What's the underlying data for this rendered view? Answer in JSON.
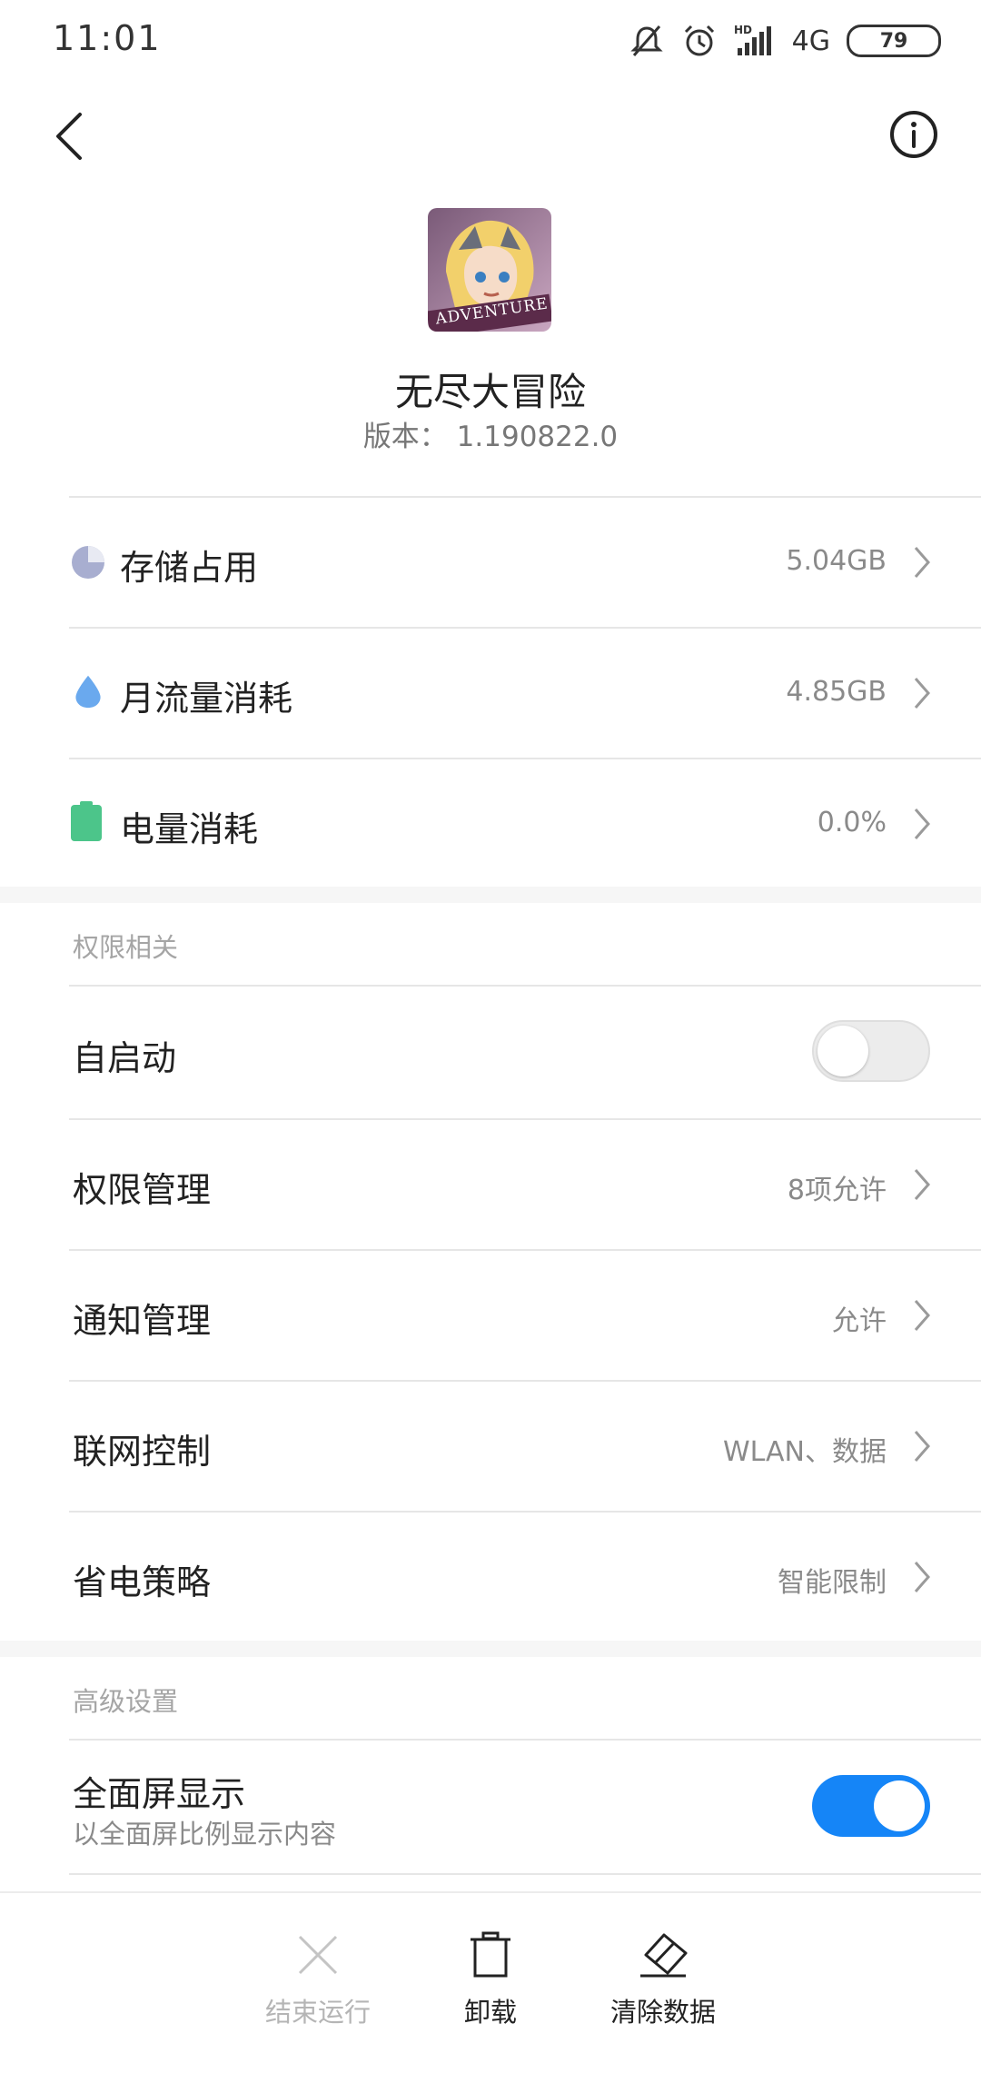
{
  "status_bar": {
    "time": "11:01",
    "network": "4G",
    "battery_level": "79",
    "icons": [
      "mute-icon",
      "alarm-icon",
      "hd-signal-icon",
      "battery-icon"
    ]
  },
  "nav": {
    "back_icon": "back-arrow-icon",
    "info_icon": "info-icon"
  },
  "app": {
    "name": "无尽大冒险",
    "version": "版本： 1.190822.0",
    "icon_text": "ADVENTURE"
  },
  "usage": [
    {
      "label": "存储占用",
      "value": "5.04GB",
      "icon": "storage-pie-icon",
      "color": "#a8aed0"
    },
    {
      "label": "月流量消耗",
      "value": "4.85GB",
      "icon": "data-drop-icon",
      "color": "#6aa9ee"
    },
    {
      "label": "电量消耗",
      "value": "0.0%",
      "icon": "battery-icon",
      "color": "#4cc58a"
    }
  ],
  "permissions": {
    "title": "权限相关",
    "autostart": {
      "label": "自启动",
      "enabled": false
    },
    "items": [
      {
        "label": "权限管理",
        "value": "8项允许"
      },
      {
        "label": "通知管理",
        "value": "允许"
      },
      {
        "label": "联网控制",
        "value": "WLAN、数据"
      },
      {
        "label": "省电策略",
        "value": "智能限制"
      }
    ]
  },
  "advanced": {
    "title": "高级设置",
    "fullscreen": {
      "label": "全面屏显示",
      "sub": "以全面屏比例显示内容",
      "enabled": true
    }
  },
  "actions": [
    {
      "label": "结束运行",
      "icon": "close-x-icon",
      "enabled": false
    },
    {
      "label": "卸载",
      "icon": "trash-icon",
      "enabled": true
    },
    {
      "label": "清除数据",
      "icon": "eraser-icon",
      "enabled": true
    }
  ],
  "colors": {
    "accent": "#1585f7",
    "disabled": "#b5b5b5"
  }
}
